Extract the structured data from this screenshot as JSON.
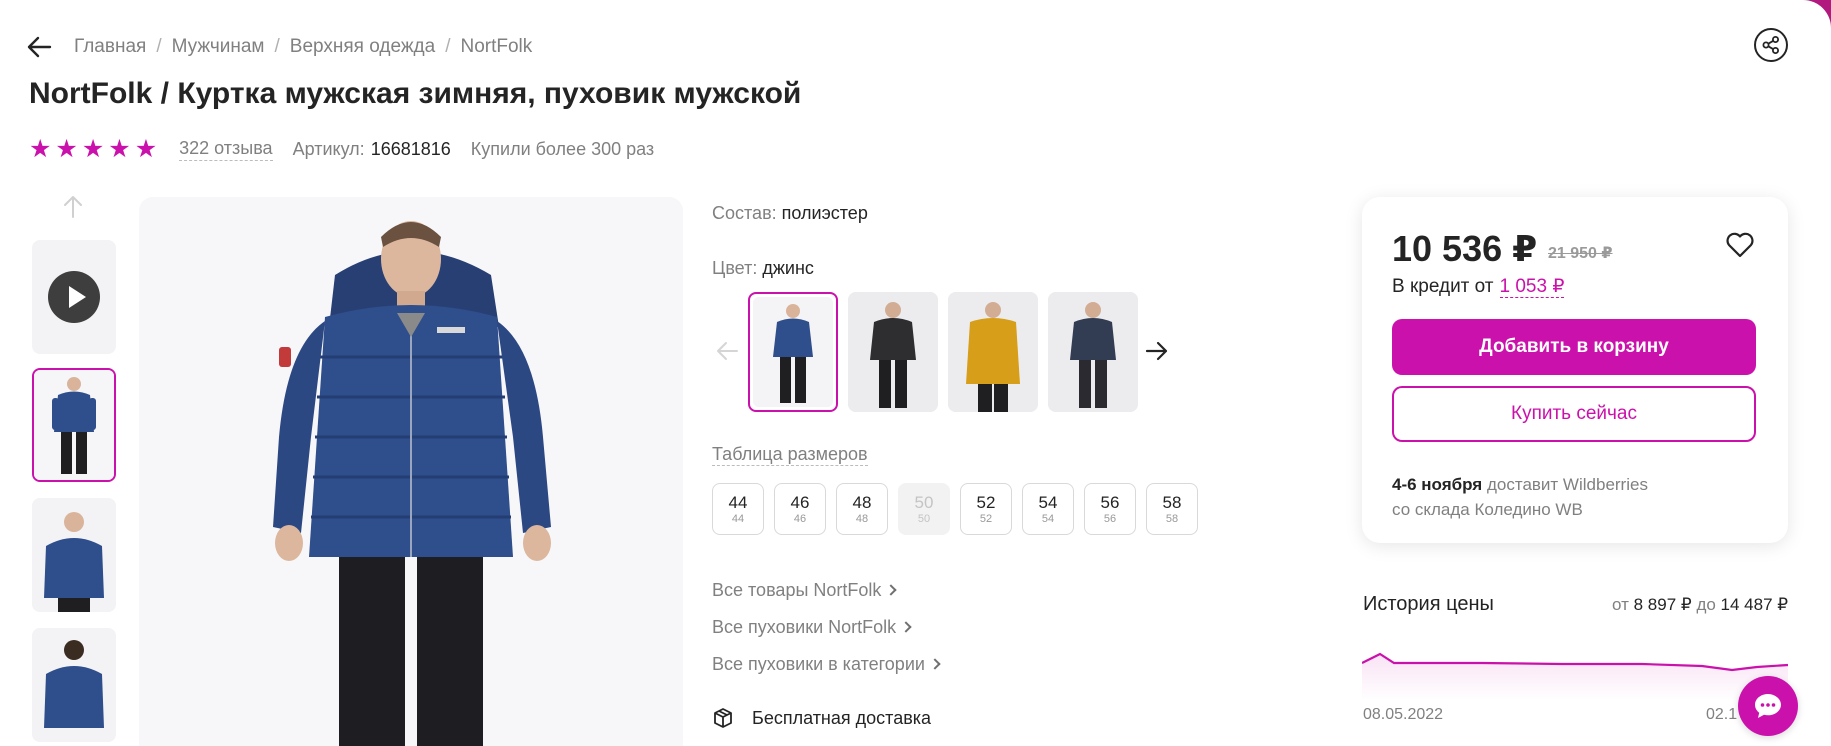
{
  "breadcrumbs": [
    "Главная",
    "Мужчинам",
    "Верхняя одежда",
    "NortFolk"
  ],
  "product": {
    "title": "NortFolk / Куртка мужская зимняя, пуховик мужской",
    "rating": 5,
    "reviews_label": "322 отзыва",
    "article_label": "Артикул:",
    "article_value": "16681816",
    "bought_label": "Купили более 300 раз"
  },
  "composition": {
    "label": "Состав:",
    "value": "полиэстер"
  },
  "color": {
    "label": "Цвет:",
    "value": "джинс",
    "swatches": [
      {
        "name": "blue",
        "jacket": "#2f4e8c",
        "selected": true
      },
      {
        "name": "black",
        "jacket": "#2e2e30",
        "selected": false
      },
      {
        "name": "mustard",
        "jacket": "#d79e19",
        "selected": false
      },
      {
        "name": "navy",
        "jacket": "#323c52",
        "selected": false
      }
    ]
  },
  "sizes": {
    "table_link": "Таблица размеров",
    "items": [
      {
        "ru": "44",
        "intl": "44",
        "available": true
      },
      {
        "ru": "46",
        "intl": "46",
        "available": true
      },
      {
        "ru": "48",
        "intl": "48",
        "available": true
      },
      {
        "ru": "50",
        "intl": "50",
        "available": false
      },
      {
        "ru": "52",
        "intl": "52",
        "available": true
      },
      {
        "ru": "54",
        "intl": "54",
        "available": true
      },
      {
        "ru": "56",
        "intl": "56",
        "available": true
      },
      {
        "ru": "58",
        "intl": "58",
        "available": true
      }
    ]
  },
  "links": [
    "Все товары NortFolk",
    "Все пуховики NortFolk",
    "Все пуховики в категории"
  ],
  "delivery_note": "Бесплатная доставка",
  "price": {
    "current": "10 536 ₽",
    "old": "21 950 ₽",
    "credit_prefix": "В кредит от",
    "credit_amount": "1 053 ₽",
    "add_to_cart": "Добавить в корзину",
    "buy_now": "Купить сейчас",
    "delivery_date": "4-6 ноября",
    "delivery_text_1": "доставит Wildberries",
    "delivery_text_2": "со склада Коледино WB"
  },
  "price_history": {
    "title": "История цены",
    "from_label": "от",
    "min": "8 897 ₽",
    "to_label": "до",
    "max": "14 487 ₽",
    "date_start": "08.05.2022",
    "date_end": "02.1"
  },
  "colors": {
    "accent": "#cb11ab",
    "text": "#242424",
    "muted": "#808080"
  }
}
